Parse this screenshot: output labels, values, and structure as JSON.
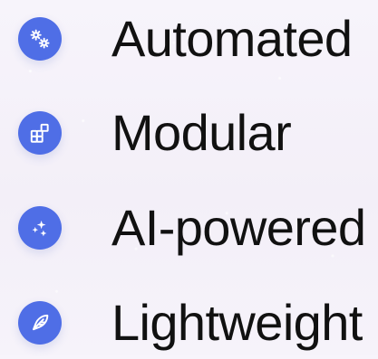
{
  "theme": {
    "icon_color": "#4f6ee6",
    "icon_stroke": "#ffffff",
    "text_color": "#111111"
  },
  "features": [
    {
      "label": "Automated",
      "icon": "gears-icon"
    },
    {
      "label": "Modular",
      "icon": "modules-icon"
    },
    {
      "label": "AI-powered",
      "icon": "sparkles-icon"
    },
    {
      "label": "Lightweight",
      "icon": "feather-icon"
    }
  ]
}
